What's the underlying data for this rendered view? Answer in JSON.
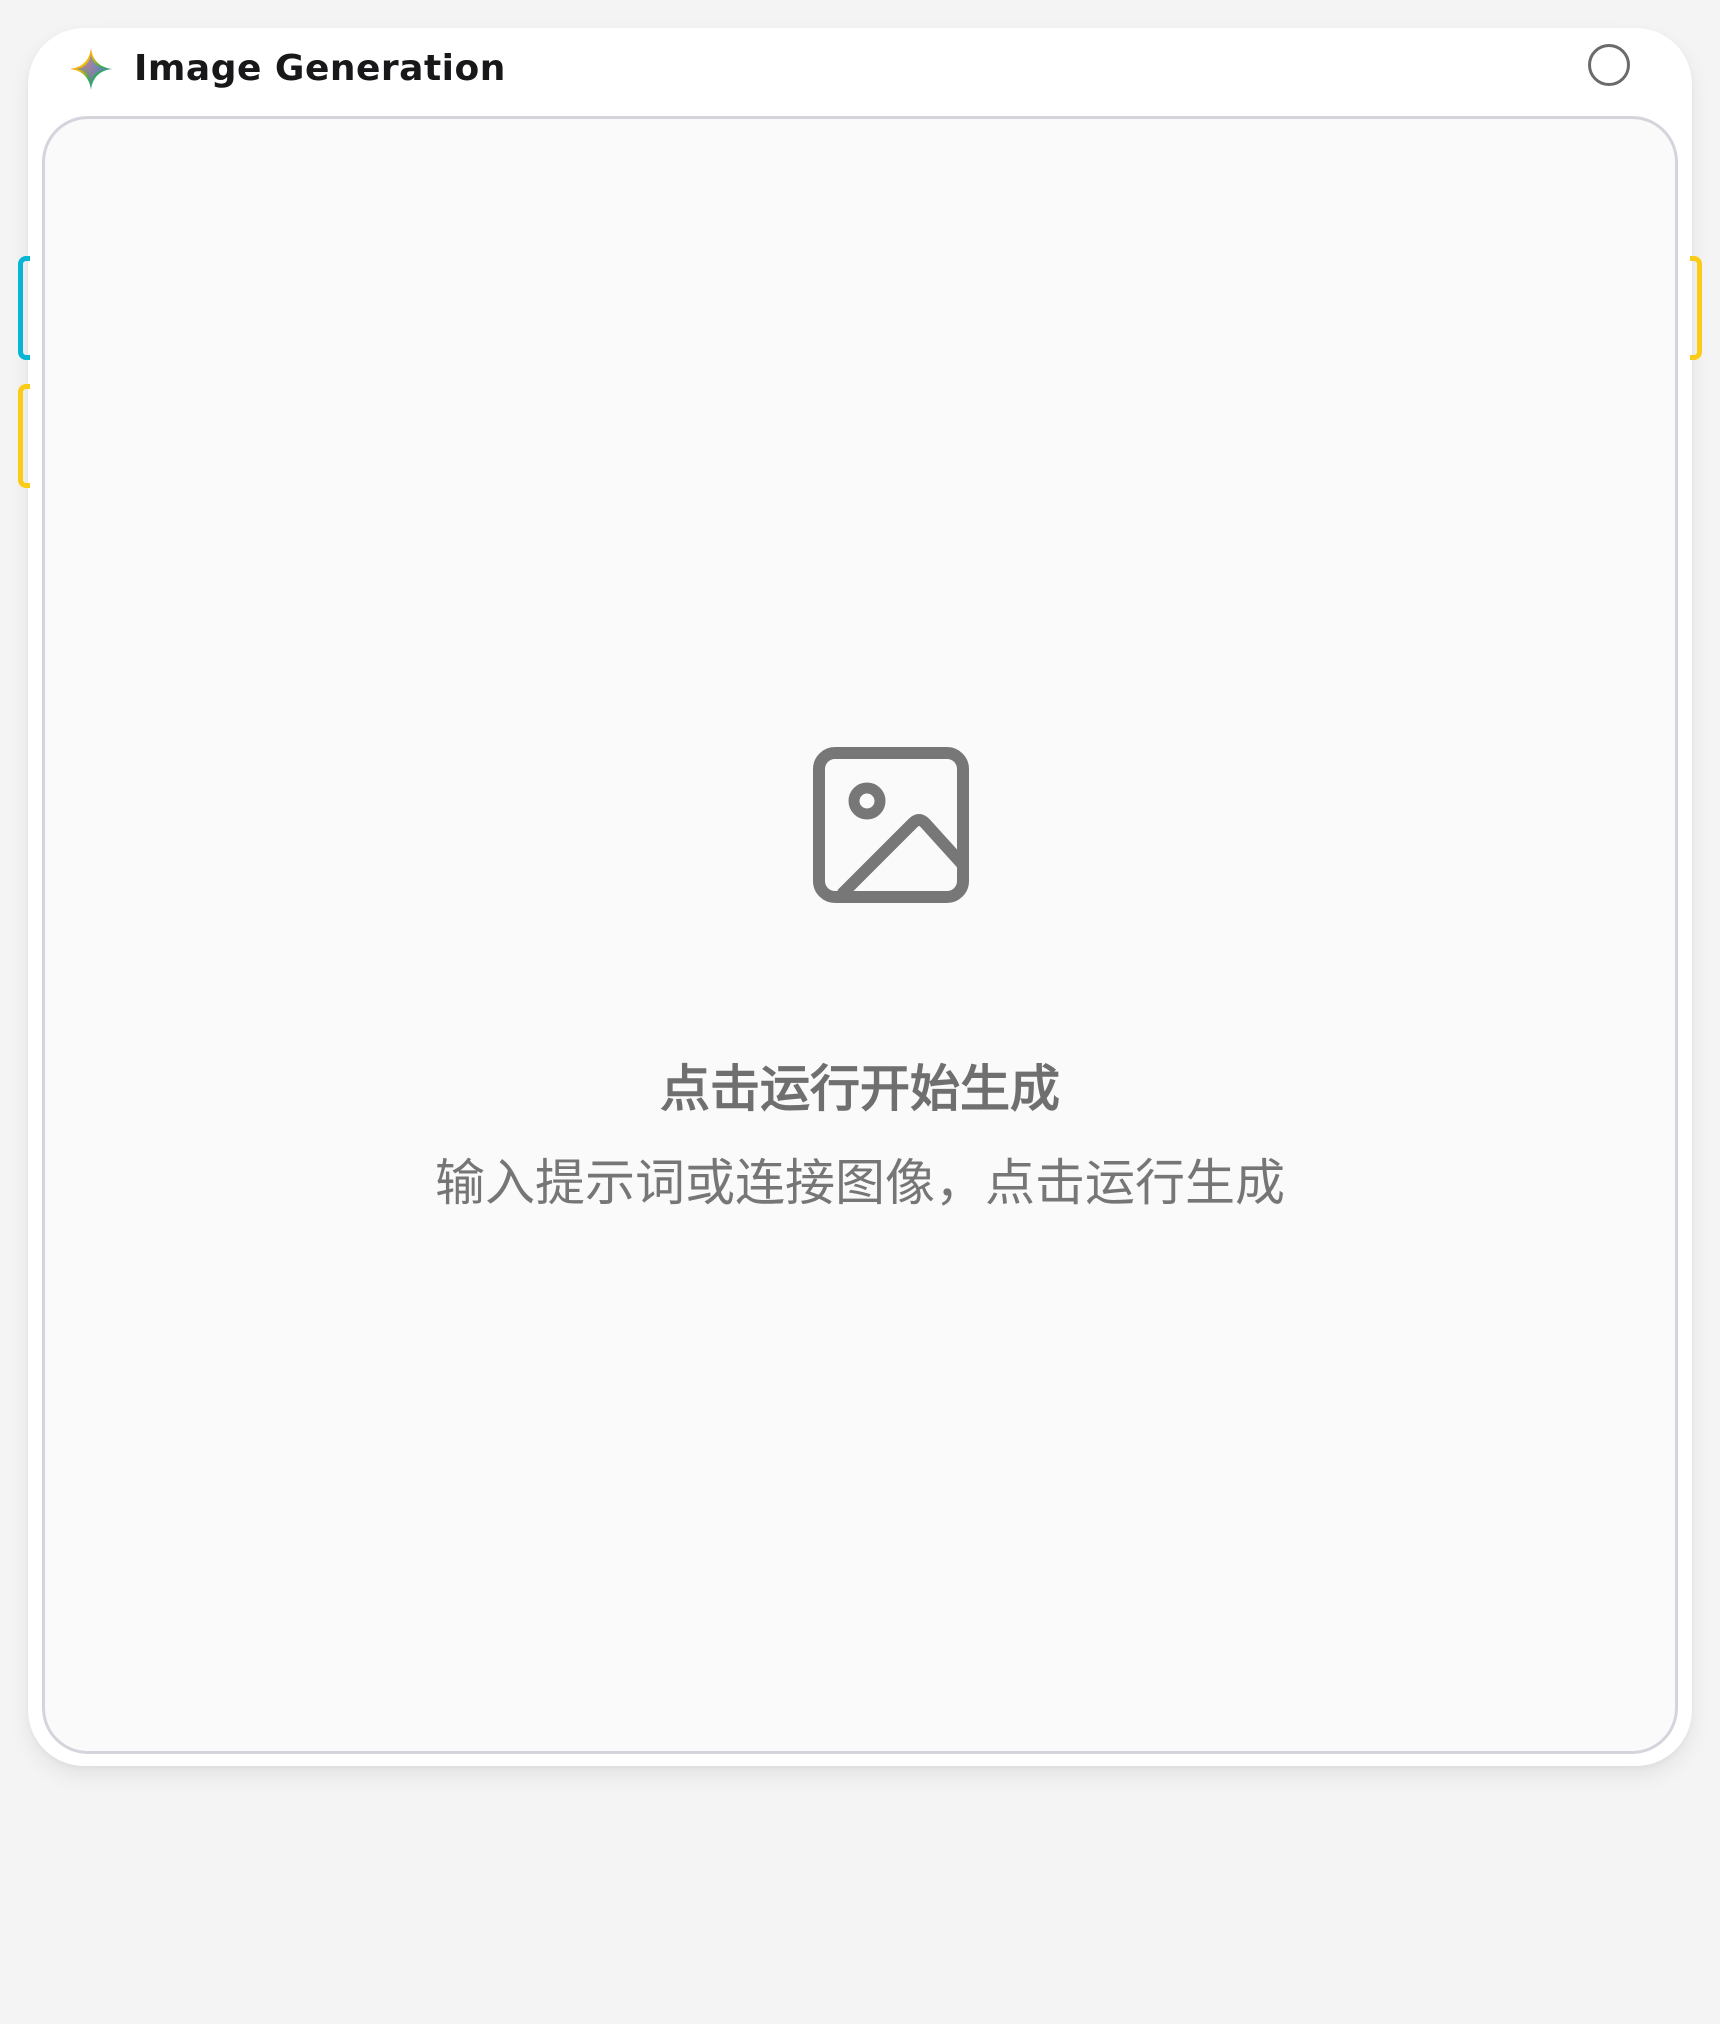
{
  "node": {
    "title": "Image Generation",
    "icon": "gemini-sparkle-icon",
    "status_icon": "status-circle-icon"
  },
  "preview": {
    "icon": "image-placeholder-icon",
    "title": "点击运行开始生成",
    "subtitle": "输入提示词或连接图像，点击运行生成"
  },
  "handles": {
    "input_text_color": "#06b6d4",
    "input_image_color": "#facc15",
    "output_image_color": "#facc15"
  },
  "colors": {
    "background": "#f4f4f5",
    "card": "#ffffff",
    "preview_bg": "#fafafa",
    "preview_border": "#d4d4dc",
    "muted_text": "#6f6f6f"
  }
}
